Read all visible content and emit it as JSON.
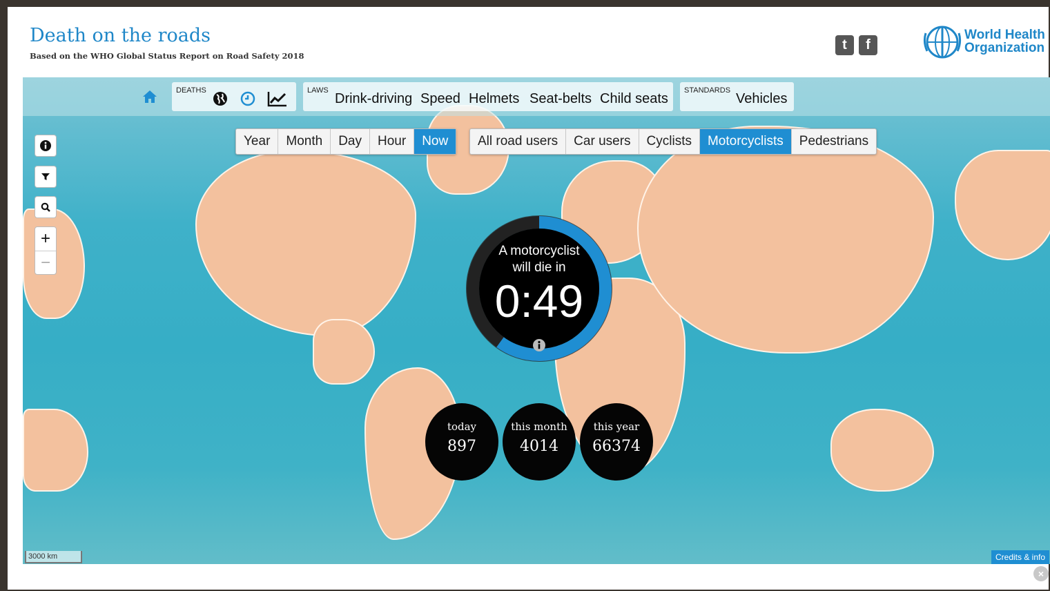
{
  "header": {
    "title": "Death on the roads",
    "subtitle": "Based on the WHO Global Status Report on Road Safety 2018",
    "social": [
      {
        "icon": "twitter-icon",
        "glyph": "t"
      },
      {
        "icon": "facebook-icon",
        "glyph": "f"
      }
    ],
    "org": {
      "line1": "World Health",
      "line2": "Organization",
      "icon": "who-emblem-icon"
    }
  },
  "nav": {
    "home_icon": "home-icon",
    "deaths_label": "DEATHS",
    "deaths_icons": [
      "globe-icon",
      "clock-icon",
      "trend-chart-icon"
    ],
    "laws_label": "LAWS",
    "laws_links": [
      "Drink-driving",
      "Speed",
      "Helmets",
      "Seat-belts",
      "Child seats"
    ],
    "standards_label": "STANDARDS",
    "standards_links": [
      "Vehicles"
    ]
  },
  "period_tabs": {
    "items": [
      "Year",
      "Month",
      "Day",
      "Hour",
      "Now"
    ],
    "selected": "Now"
  },
  "user_tabs": {
    "items": [
      "All road users",
      "Car users",
      "Cyclists",
      "Motorcyclists",
      "Pedestrians"
    ],
    "selected": "Motorcyclists"
  },
  "map_controls": {
    "info_icon": "info-icon",
    "filter_icon": "filter-icon",
    "search_icon": "search-icon",
    "zoom_in": "+",
    "zoom_out": "−",
    "scale_label": "3000 km",
    "credits_label": "Credits & info"
  },
  "countdown": {
    "line1": "A motorcyclist",
    "line2": "will die in",
    "time": "0:49",
    "progress": 0.6,
    "info_icon": "info-icon"
  },
  "stats": [
    {
      "label": "today",
      "value": "897"
    },
    {
      "label": "this month",
      "value": "4014"
    },
    {
      "label": "this year",
      "value": "66374"
    }
  ],
  "colors": {
    "accent": "#1f8ed2",
    "title": "#1f87c8",
    "land": "#f3c19e",
    "ocean": "#3fb1c9"
  }
}
